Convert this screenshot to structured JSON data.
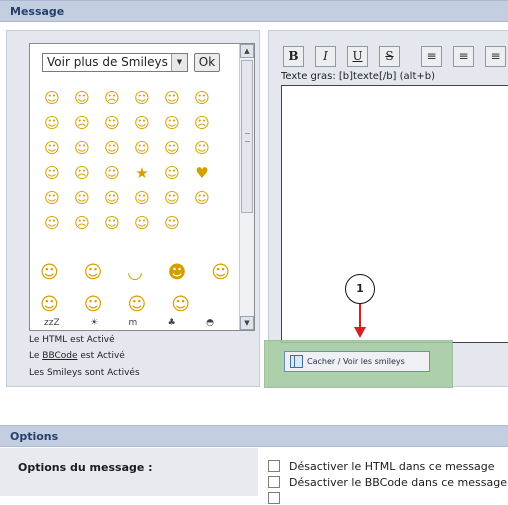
{
  "sections": {
    "message": "Message",
    "options": "Options"
  },
  "smileys": {
    "more_select": "Voir plus de Smileys",
    "ok": "Ok",
    "rows": [
      [
        "☺",
        "☺",
        "☹",
        "☺",
        "☺",
        "☺"
      ],
      [
        "☺",
        "☹",
        "☺",
        "☺",
        "☺",
        "☹"
      ],
      [
        "☺",
        "☺",
        "☺",
        "☺",
        "☺",
        "☺"
      ],
      [
        "☺",
        "☹",
        "☺",
        "★",
        "☺",
        "♥"
      ],
      [
        "☺",
        "☺",
        "☺",
        "☺",
        "☺",
        "☺"
      ],
      [
        "☺",
        "☹",
        "☺",
        "☺",
        "☺",
        ""
      ]
    ],
    "lower_row_1": [
      "☺",
      "☺",
      "◡",
      "☻",
      "☺"
    ],
    "lower_row_2": [
      "☺",
      "☺",
      "☺",
      "☺"
    ],
    "lower_row_3": [
      "zzZ",
      "☀",
      "m",
      "♣",
      "◓"
    ]
  },
  "status": {
    "html": "Le HTML est Activé",
    "bbcode_prefix": "Le ",
    "bbcode_link": "BBCode",
    "bbcode_suffix": " est Activé",
    "smileys": "Les Smileys sont Activés"
  },
  "editor": {
    "buttons": [
      "B",
      "I",
      "U",
      "S",
      "≡",
      "≡",
      "≡"
    ],
    "hint": "Texte gras: [b]texte[/b] (alt+b)",
    "textarea_value": ""
  },
  "toggle_smileys_label": "Cacher / Voir les smileys",
  "callout_number": "1",
  "options": {
    "label": "Options du message :",
    "items": [
      "Désactiver le HTML dans ce message",
      "Désactiver le BBCode dans ce message",
      ""
    ]
  }
}
